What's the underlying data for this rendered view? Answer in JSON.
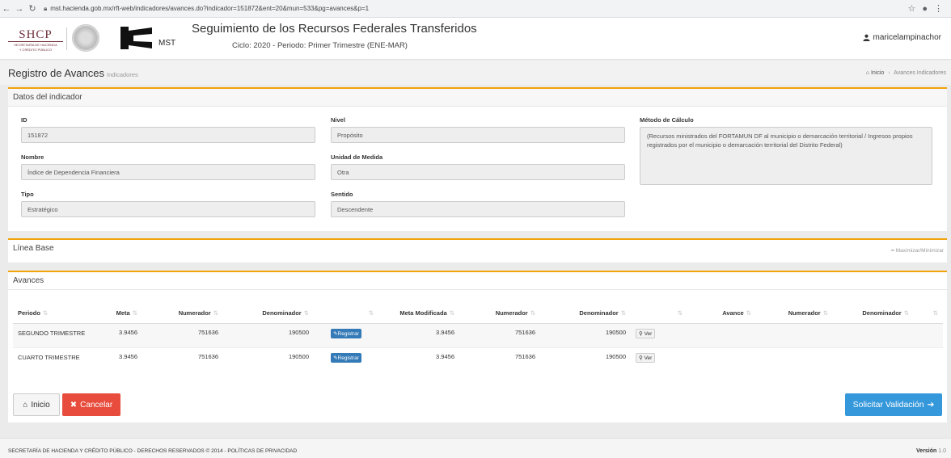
{
  "browser": {
    "url": "mst.hacienda.gob.mx/rft-web/indicadores/avances.do?indicador=151872&ent=20&mun=533&pg=avances&p=1"
  },
  "header": {
    "logo_main": "SHCP",
    "logo_caption_1": "SECRETARÍA DE HACIENDA",
    "logo_caption_2": "Y CRÉDITO PÚBLICO",
    "mst_label": "MST",
    "title": "Seguimiento de los Recursos Federales Transferidos",
    "subtitle": "Ciclo: 2020 - Periodo: Primer Trimestre (ENE-MAR)",
    "user": "maricelampinachor"
  },
  "page": {
    "title": "Registro de Avances",
    "subtitle": "Indicadores",
    "breadcrumb_home": "Inicio",
    "breadcrumb_sep": "›",
    "breadcrumb_current": "Avances Indicadores"
  },
  "datos": {
    "heading": "Datos del indicador",
    "id_label": "ID",
    "id_value": "151872",
    "nombre_label": "Nombre",
    "nombre_value": "Índice de Dependencia Financiera",
    "tipo_label": "Tipo",
    "tipo_value": "Estratégico",
    "nivel_label": "Nivel",
    "nivel_value": "Propósito",
    "unidad_label": "Unidad de Medida",
    "unidad_value": "Otra",
    "sentido_label": "Sentido",
    "sentido_value": "Descendente",
    "metodo_label": "Método de Cálculo",
    "metodo_value": "(Recursos ministrados del FORTAMUN DF al municipio o demarcación territorial / Ingresos propios registrados por el municipio o demarcación territorial del Distrito Federal)"
  },
  "linea_base": {
    "heading": "Línea Base",
    "toggle": "Maximizar/Minimizar"
  },
  "avances": {
    "heading": "Avances",
    "columns": [
      "Periodo",
      "Meta",
      "Numerador",
      "Denominador",
      "",
      "Meta Modificada",
      "Numerador",
      "Denominador",
      "",
      "Avance",
      "Numerador",
      "Denominador",
      ""
    ],
    "register_label": "Registrar",
    "view_label": "Ver",
    "rows": [
      {
        "periodo": "SEGUNDO TRIMESTRE",
        "meta": "3.9456",
        "numerador": "751636",
        "denominador": "190500",
        "meta_mod": "3.9456",
        "numerador_mod": "751636",
        "denominador_mod": "190500"
      },
      {
        "periodo": "CUARTO TRIMESTRE",
        "meta": "3.9456",
        "numerador": "751636",
        "denominador": "190500",
        "meta_mod": "3.9456",
        "numerador_mod": "751636",
        "denominador_mod": "190500"
      }
    ]
  },
  "actions": {
    "inicio": "Inicio",
    "cancelar": "Cancelar",
    "solicitar": "Solicitar Validación"
  },
  "footer": {
    "text": "SECRETARÍA DE HACIENDA Y CRÉDITO PÚBLICO - DERECHOS RESERVADOS © 2014 - POLÍTICAS DE PRIVACIDAD",
    "version_label": "Versión",
    "version_value": "1.0"
  },
  "colors": {
    "accent": "#f0a30a",
    "primary": "#337ab7",
    "danger": "#e74c3c",
    "info": "#3498db"
  }
}
